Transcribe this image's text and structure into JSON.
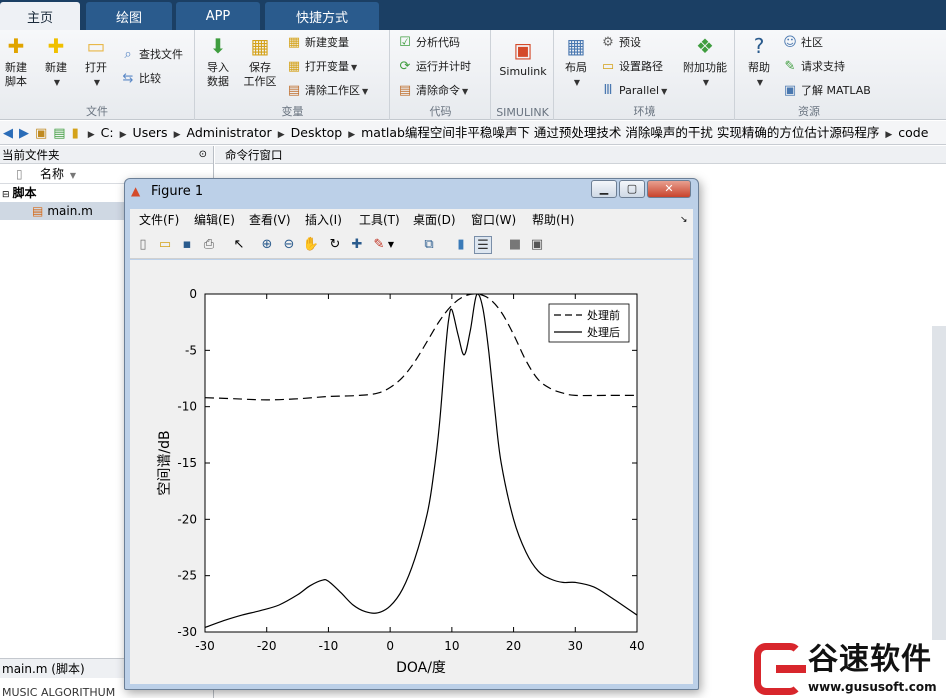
{
  "tabs": [
    "主页",
    "绘图",
    "APP",
    "快捷方式"
  ],
  "ribbon": {
    "file": {
      "label": "文件",
      "new_script": "新建\n脚本",
      "new": "新建",
      "open": "打开",
      "find_files": "查找文件",
      "compare": "比较"
    },
    "variable": {
      "label": "变量",
      "import": "导入\n数据",
      "save_ws": "保存\n工作区",
      "new_var": "新建变量",
      "open_var": "打开变量",
      "clear_ws": "清除工作区"
    },
    "code": {
      "label": "代码",
      "analyze": "分析代码",
      "run_time": "运行并计时",
      "clear_cmd": "清除命令"
    },
    "simulink": {
      "label": "SIMULINK",
      "btn": "Simulink"
    },
    "env": {
      "label": "环境",
      "layout": "布局",
      "prefs": "预设",
      "set_path": "设置路径",
      "parallel": "Parallel",
      "addons": "附加功能"
    },
    "resources": {
      "label": "资源",
      "help": "帮助",
      "community": "社区",
      "support": "请求支持",
      "learn": "了解 MATLAB"
    }
  },
  "address": {
    "segments": [
      "C:",
      "Users",
      "Administrator",
      "Desktop",
      "matlab编程空间非平稳噪声下 通过预处理技术 消除噪声的干扰 实现精确的方位估计源码程序",
      "code"
    ]
  },
  "current_folder": {
    "title": "当前文件夹",
    "col_name": "名称",
    "group": "脚本",
    "file": "main.m",
    "detail": "main.m  (脚本)",
    "detail2": "MUSIC ALGORITHUM"
  },
  "command_window": {
    "title": "命令行窗口"
  },
  "figure": {
    "title": "Figure 1",
    "menu": [
      "文件(F)",
      "编辑(E)",
      "查看(V)",
      "插入(I)",
      "工具(T)",
      "桌面(D)",
      "窗口(W)",
      "帮助(H)"
    ]
  },
  "chart_data": {
    "type": "line",
    "title": "",
    "xlabel": "DOA/度",
    "ylabel": "空间谱/dB",
    "xlim": [
      -30,
      40
    ],
    "ylim": [
      -30,
      0
    ],
    "xticks": [
      -30,
      -20,
      -10,
      0,
      10,
      20,
      30,
      40
    ],
    "yticks": [
      0,
      -5,
      -10,
      -15,
      -20,
      -25,
      -30
    ],
    "legend_position": "top-right",
    "series": [
      {
        "name": "处理前",
        "style": "dashed",
        "x": [
          -30,
          -25,
          -20,
          -15,
          -10,
          -5,
          -2,
          0,
          2,
          4,
          6,
          8,
          10,
          12,
          14,
          16,
          18,
          20,
          22,
          24,
          26,
          28,
          30,
          35,
          40
        ],
        "y": [
          -9.2,
          -9.3,
          -9.4,
          -9.3,
          -9.1,
          -9.0,
          -8.8,
          -8.3,
          -7.4,
          -6.0,
          -4.2,
          -2.4,
          -1.0,
          -0.2,
          0.0,
          -0.4,
          -1.6,
          -3.6,
          -5.9,
          -7.6,
          -8.4,
          -8.8,
          -9.0,
          -9.0,
          -9.0
        ]
      },
      {
        "name": "处理后",
        "style": "solid",
        "x": [
          -30,
          -27,
          -24,
          -21,
          -18,
          -15,
          -13,
          -11,
          -10,
          -8,
          -6,
          -4,
          -2,
          0,
          2,
          4,
          6,
          7,
          8,
          9,
          9.5,
          10,
          11,
          12,
          13,
          14,
          15,
          16,
          17,
          18,
          20,
          22,
          24,
          26,
          28,
          30,
          33,
          36,
          40
        ],
        "y": [
          -29.6,
          -29.0,
          -28.5,
          -28.1,
          -27.6,
          -26.7,
          -25.9,
          -25.4,
          -25.5,
          -26.5,
          -27.6,
          -28.2,
          -28.3,
          -27.7,
          -26.2,
          -23.5,
          -19.5,
          -16.2,
          -11.5,
          -4.8,
          -2.2,
          -1.4,
          -3.6,
          -5.4,
          -3.2,
          -0.1,
          -1.2,
          -5.2,
          -10.5,
          -15.0,
          -20.0,
          -22.9,
          -24.6,
          -25.3,
          -25.6,
          -25.6,
          -26.0,
          -27.0,
          -28.5
        ]
      }
    ],
    "colors": {
      "line": "#000000",
      "axes_bg": "#ffffff",
      "figure_bg": "#f0f0f0"
    }
  },
  "watermark": {
    "name": "谷速软件",
    "url": "www.gususoft.com"
  }
}
